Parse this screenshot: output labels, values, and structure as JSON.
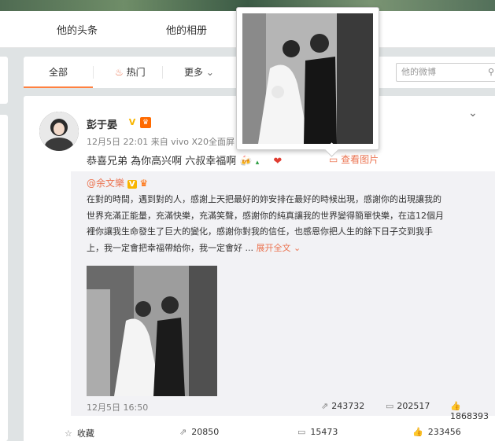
{
  "nav": {
    "tabs": [
      "他的头条",
      "他的相册"
    ]
  },
  "filter": {
    "tabs": [
      {
        "label": "全部",
        "active": true
      },
      {
        "label": "热门",
        "icon": "flame-icon"
      },
      {
        "label": "更多",
        "icon": "chevron-down-icon"
      }
    ],
    "search_placeholder": "他的微博"
  },
  "post": {
    "author": "彭于晏",
    "verified": "V",
    "meta": "12月5日 22:01 来自 vivo X20全面屏",
    "text": "恭喜兄弟 為你高兴啊 六叔幸福啊",
    "view_picture": "查看图片",
    "repost": {
      "author": "@余文樂",
      "verified": "V",
      "lines": [
        "在對的時間，遇到對的人，感謝上天把最好的妳安排在最好的時候出現，感謝你的出現讓我的",
        "世界充滿正能量，充滿快樂，充滿笑聲，感謝你的純真讓我的世界變得簡單快樂，在這12個月",
        "裡你讓我生命發生了巨大的變化，感謝你對我的信任，也感恩你把人生的餘下日子交到我手",
        "上，我一定會把幸福帶給你，我一定會好 ..."
      ],
      "expand": "展开全文",
      "date": "12月5日 16:50",
      "forwards": "243732",
      "comments": "202517",
      "likes": "1868393"
    },
    "actions": {
      "favorite": "收藏",
      "forwards": "20850",
      "comments": "15473",
      "likes": "233456"
    }
  },
  "colors": {
    "accent": "#eb7350",
    "verified_bg": "#f8b500",
    "tab_active": "#ff8140"
  }
}
